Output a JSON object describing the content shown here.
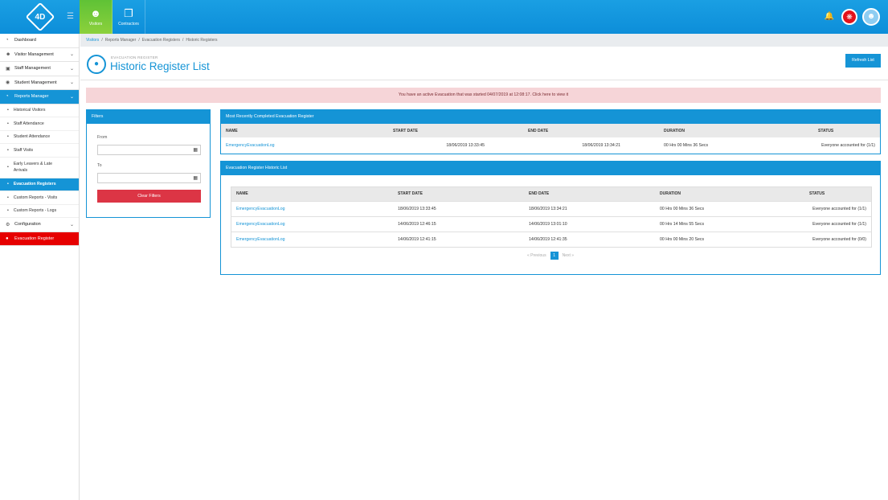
{
  "brand": {
    "logo_text": "4D"
  },
  "topnav": {
    "tabs": [
      {
        "label": "Visitors",
        "icon": "user-icon"
      },
      {
        "label": "Contractors",
        "icon": "clipboard-icon"
      }
    ],
    "right_icons": [
      "bell-icon",
      "evacuation-drop-icon",
      "user-avatar-icon"
    ]
  },
  "sidebar": {
    "dashboard": "Dashboard",
    "visitor_management": "Visitor Management",
    "staff_management": "Staff Management",
    "student_management": "Student Management",
    "reports_manager": "Reports Manager",
    "reports": [
      "Historical Visitors",
      "Staff Attendance",
      "Student Attendance",
      "Staff Visits",
      "Early Leavers & Late Arrivals",
      "Evacuation Registers",
      "Custom Reports - Visits",
      "Custom Reports - Logs"
    ],
    "configuration": "Configuration",
    "evacuation_register": "Evacuation Register"
  },
  "breadcrumb": [
    "Visitors",
    "Reports Manager",
    "Evacuation Registers",
    "Historic Registers"
  ],
  "page": {
    "kicker": "EVACUATION REGISTER",
    "title": "Historic Register List",
    "refresh_label": "Refresh List"
  },
  "alert_text": "You have an active Evacuation that was started 04/07/2019 at 12:08:17. Click here to view it",
  "filters": {
    "title": "Filters",
    "from_label": "From",
    "from_value": "",
    "to_label": "To",
    "to_value": "",
    "clear_label": "Clear Filters"
  },
  "recent": {
    "title": "Most Recently Completed Evacuation Register",
    "columns": [
      "NAME",
      "START DATE",
      "END DATE",
      "DURATION",
      "STATUS"
    ],
    "row": [
      "EmergencyEvacuationLog",
      "18/06/2019 13:33:45",
      "18/06/2019 13:34:21",
      "00 Hrs 00 Mins 36 Secs",
      "Everyone accounted for (1/1)"
    ]
  },
  "historic": {
    "title": "Evacuation Register Historic List",
    "columns": [
      "NAME",
      "START DATE",
      "END DATE",
      "DURATION",
      "STATUS"
    ],
    "rows": [
      [
        "EmergencyEvacuationLog",
        "18/06/2019 13:33:45",
        "18/06/2019 13:34:21",
        "00 Hrs 00 Mins 36 Secs",
        "Everyone accounted for (1/1)"
      ],
      [
        "EmergencyEvacuationLog",
        "14/06/2019 12:46:15",
        "14/06/2019 13:01:10",
        "00 Hrs 14 Mins 55 Secs",
        "Everyone accounted for (1/1)"
      ],
      [
        "EmergencyEvacuationLog",
        "14/06/2019 12:41:15",
        "14/06/2019 12:41:35",
        "00 Hrs 00 Mins 20 Secs",
        "Everyone accounted for (0/0)"
      ]
    ],
    "pager": {
      "previous": "« Previous",
      "current": "1",
      "next": "Next »"
    }
  }
}
